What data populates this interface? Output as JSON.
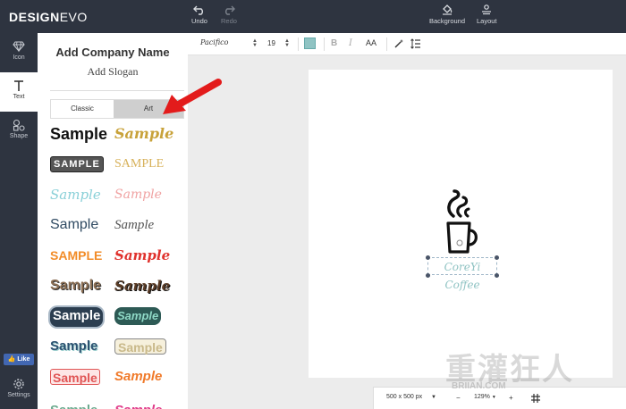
{
  "app": {
    "logo_main": "DESIGN",
    "logo_accent": "EVO"
  },
  "topbar": {
    "undo_label": "Undo",
    "redo_label": "Redo",
    "background_label": "Background",
    "layout_label": "Layout"
  },
  "rail": {
    "items": [
      {
        "label": "Icon",
        "icon": "diamond-icon"
      },
      {
        "label": "Text",
        "icon": "text-t-icon"
      },
      {
        "label": "Shape",
        "icon": "shapes-icon"
      }
    ],
    "like_label": "Like",
    "settings_label": "Settings"
  },
  "panel": {
    "add_company": "Add Company Name",
    "add_slogan": "Add Slogan",
    "tabs": [
      {
        "label": "Classic"
      },
      {
        "label": "Art"
      }
    ],
    "samples": [
      {
        "text": "Sample",
        "color": "#111111"
      },
      {
        "text": "Sample",
        "color": "#c8a23a"
      },
      {
        "text": "SAMPLE",
        "color": "#444444"
      },
      {
        "text": "SAMPLE",
        "color": "#d7b15a"
      },
      {
        "text": "Sample",
        "color": "#8ad0d8"
      },
      {
        "text": "Sample",
        "color": "#f0a3a3"
      },
      {
        "text": "Sample",
        "color": "#2f4a62"
      },
      {
        "text": "Sample",
        "color": "#555555"
      },
      {
        "text": "SAMPLE",
        "color": "#f28c28"
      },
      {
        "text": "Sample",
        "color": "#e0322d"
      },
      {
        "text": "Sample",
        "color": "#8a6d52"
      },
      {
        "text": "Sample",
        "color": "#5a3b25"
      },
      {
        "text": "Sample",
        "color": "#ffffff"
      },
      {
        "text": "Sample",
        "color": "#8fd9c6"
      },
      {
        "text": "Sample",
        "color": "#2c5170"
      },
      {
        "text": "Sample",
        "color": "#c9b98a"
      },
      {
        "text": "Sample",
        "color": "#e05555"
      },
      {
        "text": "Sample",
        "color": "#f07a2a"
      },
      {
        "text": "Sample",
        "color": "#6cab8f"
      },
      {
        "text": "Sample",
        "color": "#e03c8a"
      }
    ]
  },
  "toolbar": {
    "font_name": "Pacifico",
    "font_size": "19",
    "bold": "B",
    "italic": "I",
    "case": "AA",
    "text_color": "#8fc3c3"
  },
  "canvas": {
    "logo_text": "CoreYi Coffee"
  },
  "bottombar": {
    "canvas_size": "500 x 500 px",
    "zoom": "129%",
    "zoom_minus": "−",
    "zoom_plus": "+"
  },
  "watermark": {
    "text": "重灌狂人",
    "url": "BRIIAN.COM"
  }
}
